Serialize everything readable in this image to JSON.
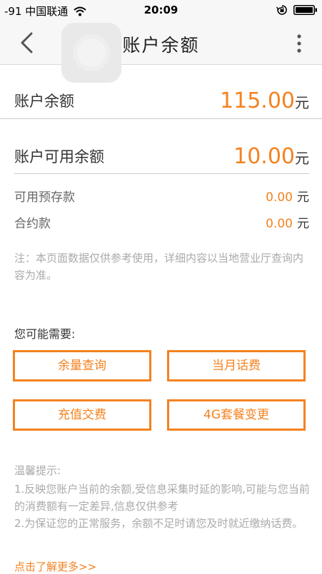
{
  "status_bar": {
    "carrier": "-91 中国联通",
    "time": "20:09"
  },
  "nav": {
    "title": "账户余额"
  },
  "balance": {
    "label": "账户余额",
    "value": "115.00",
    "unit": "元"
  },
  "available": {
    "label": "账户可用余额",
    "value": "10.00",
    "unit": "元"
  },
  "details": [
    {
      "label": "可用预存款",
      "value": "0.00",
      "unit": "元"
    },
    {
      "label": "合约款",
      "value": "0.00",
      "unit": "元"
    }
  ],
  "note": "注：本页面数据仅供参考使用，详细内容以当地营业厅查询内容为准。",
  "suggestions": {
    "title": "您可能需要:",
    "buttons": [
      "余量查询",
      "当月话费",
      "充值交费",
      "4G套餐变更"
    ]
  },
  "tips": {
    "title": "温馨提示:",
    "line1": "1.反映您账户当前的余额,受信息采集时延的影响,可能与您当前的消费额有一定差异,信息仅供参考",
    "line2": "2.为保证您的正常服务，余额不足时请您及时就近缴纳话费。",
    "learn_more": "点击了解更多>>"
  },
  "colors": {
    "accent": "#f4821f",
    "note_text": "#aaaaaa",
    "nav_background": "#f7f7f7"
  },
  "icons": [
    "wifi-icon",
    "rotation-lock-icon",
    "battery-icon",
    "back-chevron-icon",
    "more-vertical-icon"
  ]
}
